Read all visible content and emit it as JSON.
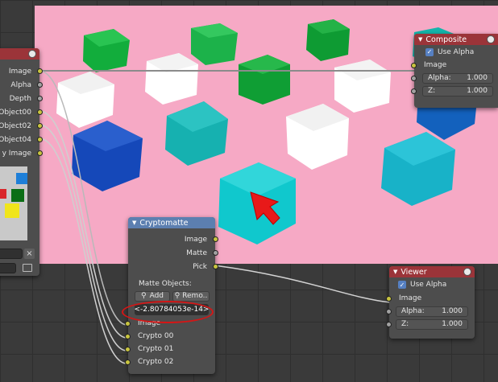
{
  "left_node": {
    "outputs": [
      "Image",
      "Alpha",
      "Depth",
      "Object00",
      "Object02",
      "Object04",
      "y Image"
    ],
    "close_glyph": "×"
  },
  "composite": {
    "title": "Composite",
    "use_alpha_label": "Use Alpha",
    "image_label": "Image",
    "alpha_label": "Alpha:",
    "alpha_value": "1.000",
    "z_label": "Z:",
    "z_value": "1.000"
  },
  "cryptomatte": {
    "title": "Cryptomatte",
    "outputs": [
      "Image",
      "Matte",
      "Pick"
    ],
    "matte_objects_label": "Matte Objects:",
    "add_label": "Add",
    "remove_label": "Remo..",
    "matte_id": "<-2.80784053e-14>",
    "inputs": [
      "Image",
      "Crypto 00",
      "Crypto 01",
      "Crypto 02"
    ]
  },
  "viewer": {
    "title": "Viewer",
    "use_alpha_label": "Use Alpha",
    "image_label": "Image",
    "alpha_label": "Alpha:",
    "alpha_value": "1.000",
    "z_label": "Z:",
    "z_value": "1.000"
  },
  "colors": {
    "backdrop": "#f6a9c5",
    "node_body": "#4d4d4d",
    "header_output": "#9b3439",
    "header_matte": "#5c7fb0",
    "socket_color": "#c8c43f",
    "socket_value": "#a1a1a1",
    "highlight": "#d41616",
    "pick_arrow": "#e81919"
  },
  "cubes": [
    {
      "color": "green"
    },
    {
      "color": "green"
    },
    {
      "color": "green"
    },
    {
      "color": "green"
    },
    {
      "color": "teal"
    },
    {
      "color": "white"
    },
    {
      "color": "white"
    },
    {
      "color": "white"
    },
    {
      "color": "white"
    },
    {
      "color": "white"
    },
    {
      "color": "teal"
    },
    {
      "color": "blue"
    },
    {
      "color": "teal"
    },
    {
      "color": "cyan"
    },
    {
      "color": "blue"
    }
  ]
}
